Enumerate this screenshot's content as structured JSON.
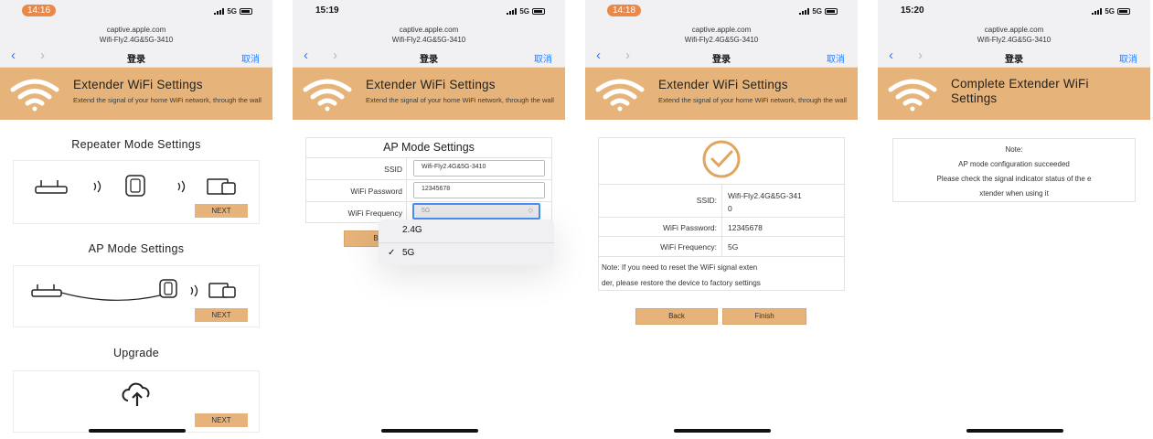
{
  "browser": {
    "host": "captive.apple.com",
    "network": "Wifi-Fly2.4G&5G-3410",
    "title": "登录",
    "cancel": "取消",
    "back_icon": "chevron-left-icon",
    "forward_icon": "chevron-right-icon",
    "carrier": "5G"
  },
  "screens": [
    {
      "time": "14:16",
      "banner": {
        "title": "Extender WiFi Settings",
        "subtitle": "Extend the signal of your home WiFi network, through the wall"
      },
      "sections": [
        {
          "title": "Repeater Mode Settings",
          "button": "NEXT",
          "diagram": "repeater-diagram-icon"
        },
        {
          "title": "AP Mode Settings",
          "button": "NEXT",
          "diagram": "ap-diagram-icon"
        },
        {
          "title": "Upgrade",
          "button": "NEXT",
          "diagram": "cloud-upload-icon"
        }
      ]
    },
    {
      "time": "15:19",
      "banner": {
        "title": "Extender WiFi Settings",
        "subtitle": "Extend the signal of your home WiFi network, through the wall"
      },
      "form": {
        "title": "AP Mode Settings",
        "ssid_label": "SSID",
        "ssid_value": "Wifi-Fly2.4G&5G-3410",
        "password_label": "WiFi Password",
        "password_value": "12345678",
        "frequency_label": "WiFi Frequency",
        "frequency_value": "5G",
        "button_partial": "B"
      },
      "dropdown": {
        "options": [
          "2.4G",
          "5G"
        ],
        "selected": "5G",
        "check": "✓"
      }
    },
    {
      "time": "14:18",
      "banner": {
        "title": "Extender WiFi Settings",
        "subtitle": "Extend the signal of your home WiFi network, through the wall"
      },
      "summary": {
        "status_icon": "check-circle-icon",
        "ssid_label": "SSID:",
        "ssid_value_line1": "Wifi-Fly2.4G&5G-341",
        "ssid_value_line2": "0",
        "password_label": "WiFi Password:",
        "password_value": "12345678",
        "frequency_label": "WiFi Frequency:",
        "frequency_value": "5G",
        "note_line1": "Note: If you need to reset the WiFi signal exten",
        "note_line2": "der, please restore the device to factory settings",
        "back": "Back",
        "finish": "Finish"
      }
    },
    {
      "time": "15:20",
      "banner": {
        "title_line1": "Complete Extender WiFi",
        "title_line2": "Settings"
      },
      "result": {
        "note_title": "Note:",
        "line1": "AP mode configuration succeeded",
        "line2": "Please check the signal indicator status of the e",
        "line3": "xtender when using it"
      }
    }
  ],
  "colors": {
    "accent": "#e6b47a",
    "link": "#2f7cf6",
    "time_pill": "#e8894a",
    "check_ring": "#e0a55f"
  }
}
